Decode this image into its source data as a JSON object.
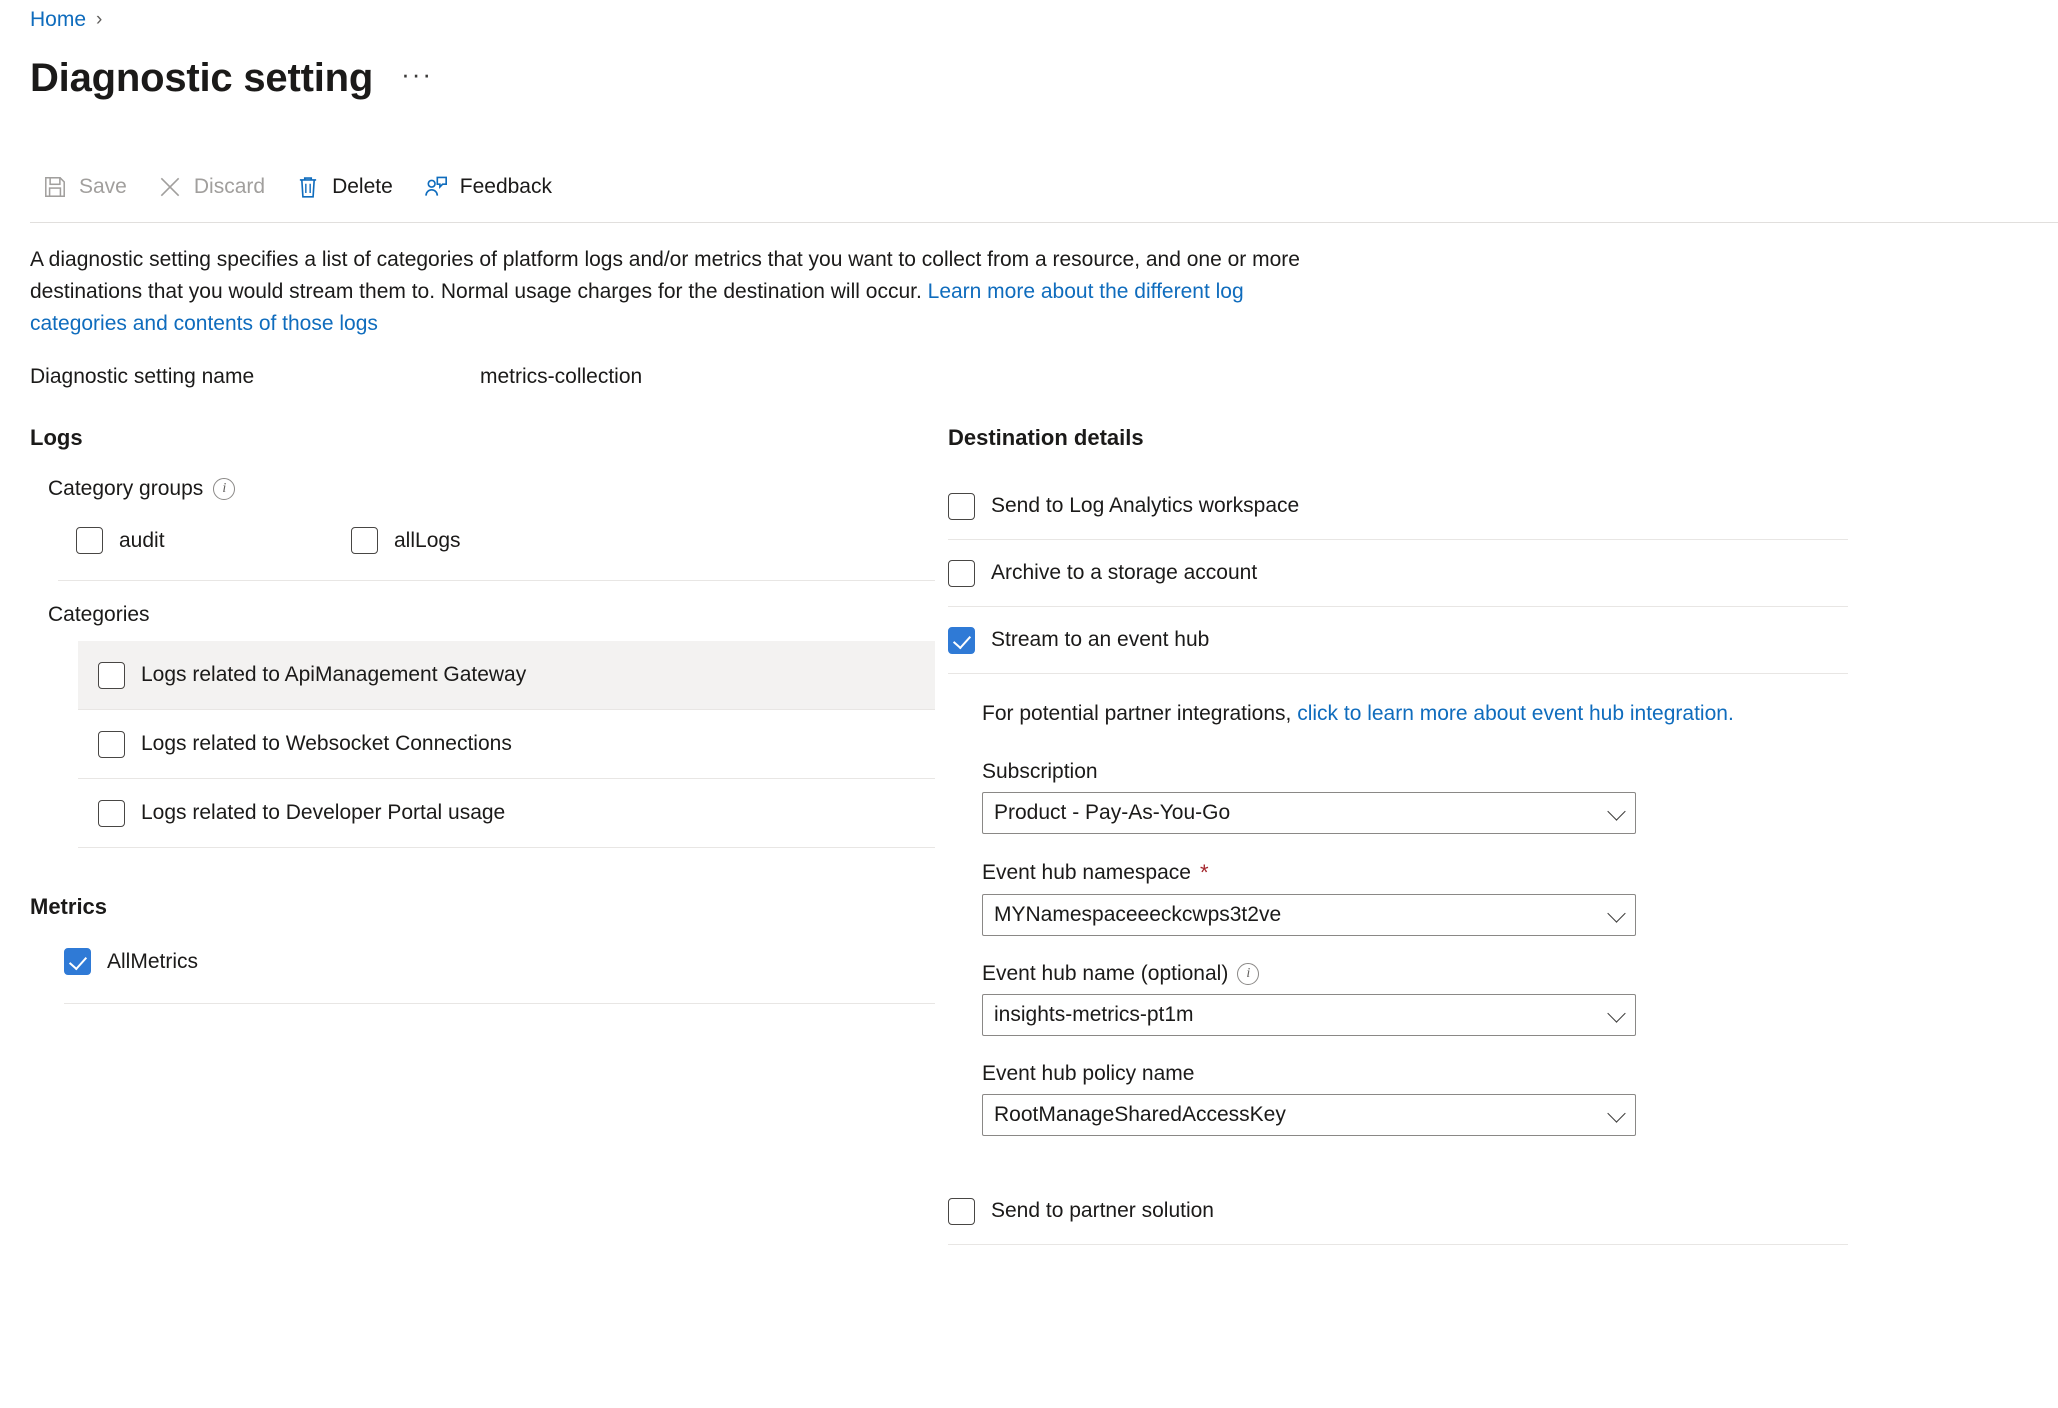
{
  "breadcrumb": {
    "home": "Home",
    "separator": "›"
  },
  "header": {
    "title": "Diagnostic setting",
    "more_label": "···"
  },
  "toolbar": {
    "save_label": "Save",
    "discard_label": "Discard",
    "delete_label": "Delete",
    "feedback_label": "Feedback"
  },
  "description": {
    "part1": "A diagnostic setting specifies a list of categories of platform logs and/or metrics that you want to collect from a resource, and one or more destinations that you would stream them to. Normal usage charges for the destination will occur. ",
    "link": "Learn more about the different log categories and contents of those logs"
  },
  "setting_name": {
    "label": "Diagnostic setting name",
    "value": "metrics-collection"
  },
  "logs": {
    "heading": "Logs",
    "category_groups_label": "Category groups",
    "info_glyph": "i",
    "groups": [
      {
        "label": "audit",
        "checked": false
      },
      {
        "label": "allLogs",
        "checked": false
      }
    ],
    "categories_label": "Categories",
    "categories": [
      {
        "label": "Logs related to ApiManagement Gateway",
        "checked": false,
        "selected": true
      },
      {
        "label": "Logs related to Websocket Connections",
        "checked": false,
        "selected": false
      },
      {
        "label": "Logs related to Developer Portal usage",
        "checked": false,
        "selected": false
      }
    ]
  },
  "metrics": {
    "heading": "Metrics",
    "items": [
      {
        "label": "AllMetrics",
        "checked": true
      }
    ]
  },
  "destination": {
    "heading": "Destination details",
    "options": [
      {
        "label": "Send to Log Analytics workspace",
        "checked": false
      },
      {
        "label": "Archive to a storage account",
        "checked": false
      },
      {
        "label": "Stream to an event hub",
        "checked": true
      }
    ],
    "partner_text": "For potential partner integrations, ",
    "partner_link": "click to learn more about event hub integration.",
    "fields": [
      {
        "label": "Subscription",
        "required": false,
        "info": false,
        "value": "Product - Pay-As-You-Go"
      },
      {
        "label": "Event hub namespace",
        "required": true,
        "info": false,
        "value": "MYNamespaceeeckcwps3t2ve"
      },
      {
        "label": "Event hub name (optional)",
        "required": false,
        "info": true,
        "value": "insights-metrics-pt1m"
      },
      {
        "label": "Event hub policy name",
        "required": false,
        "info": false,
        "value": "RootManageSharedAccessKey"
      }
    ],
    "partner_solution": {
      "label": "Send to partner solution",
      "checked": false
    }
  },
  "colors": {
    "link": "#0f6cbd",
    "accent": "#2f7ad6",
    "required": "#a4262c",
    "selected_row": "#f3f2f1"
  }
}
